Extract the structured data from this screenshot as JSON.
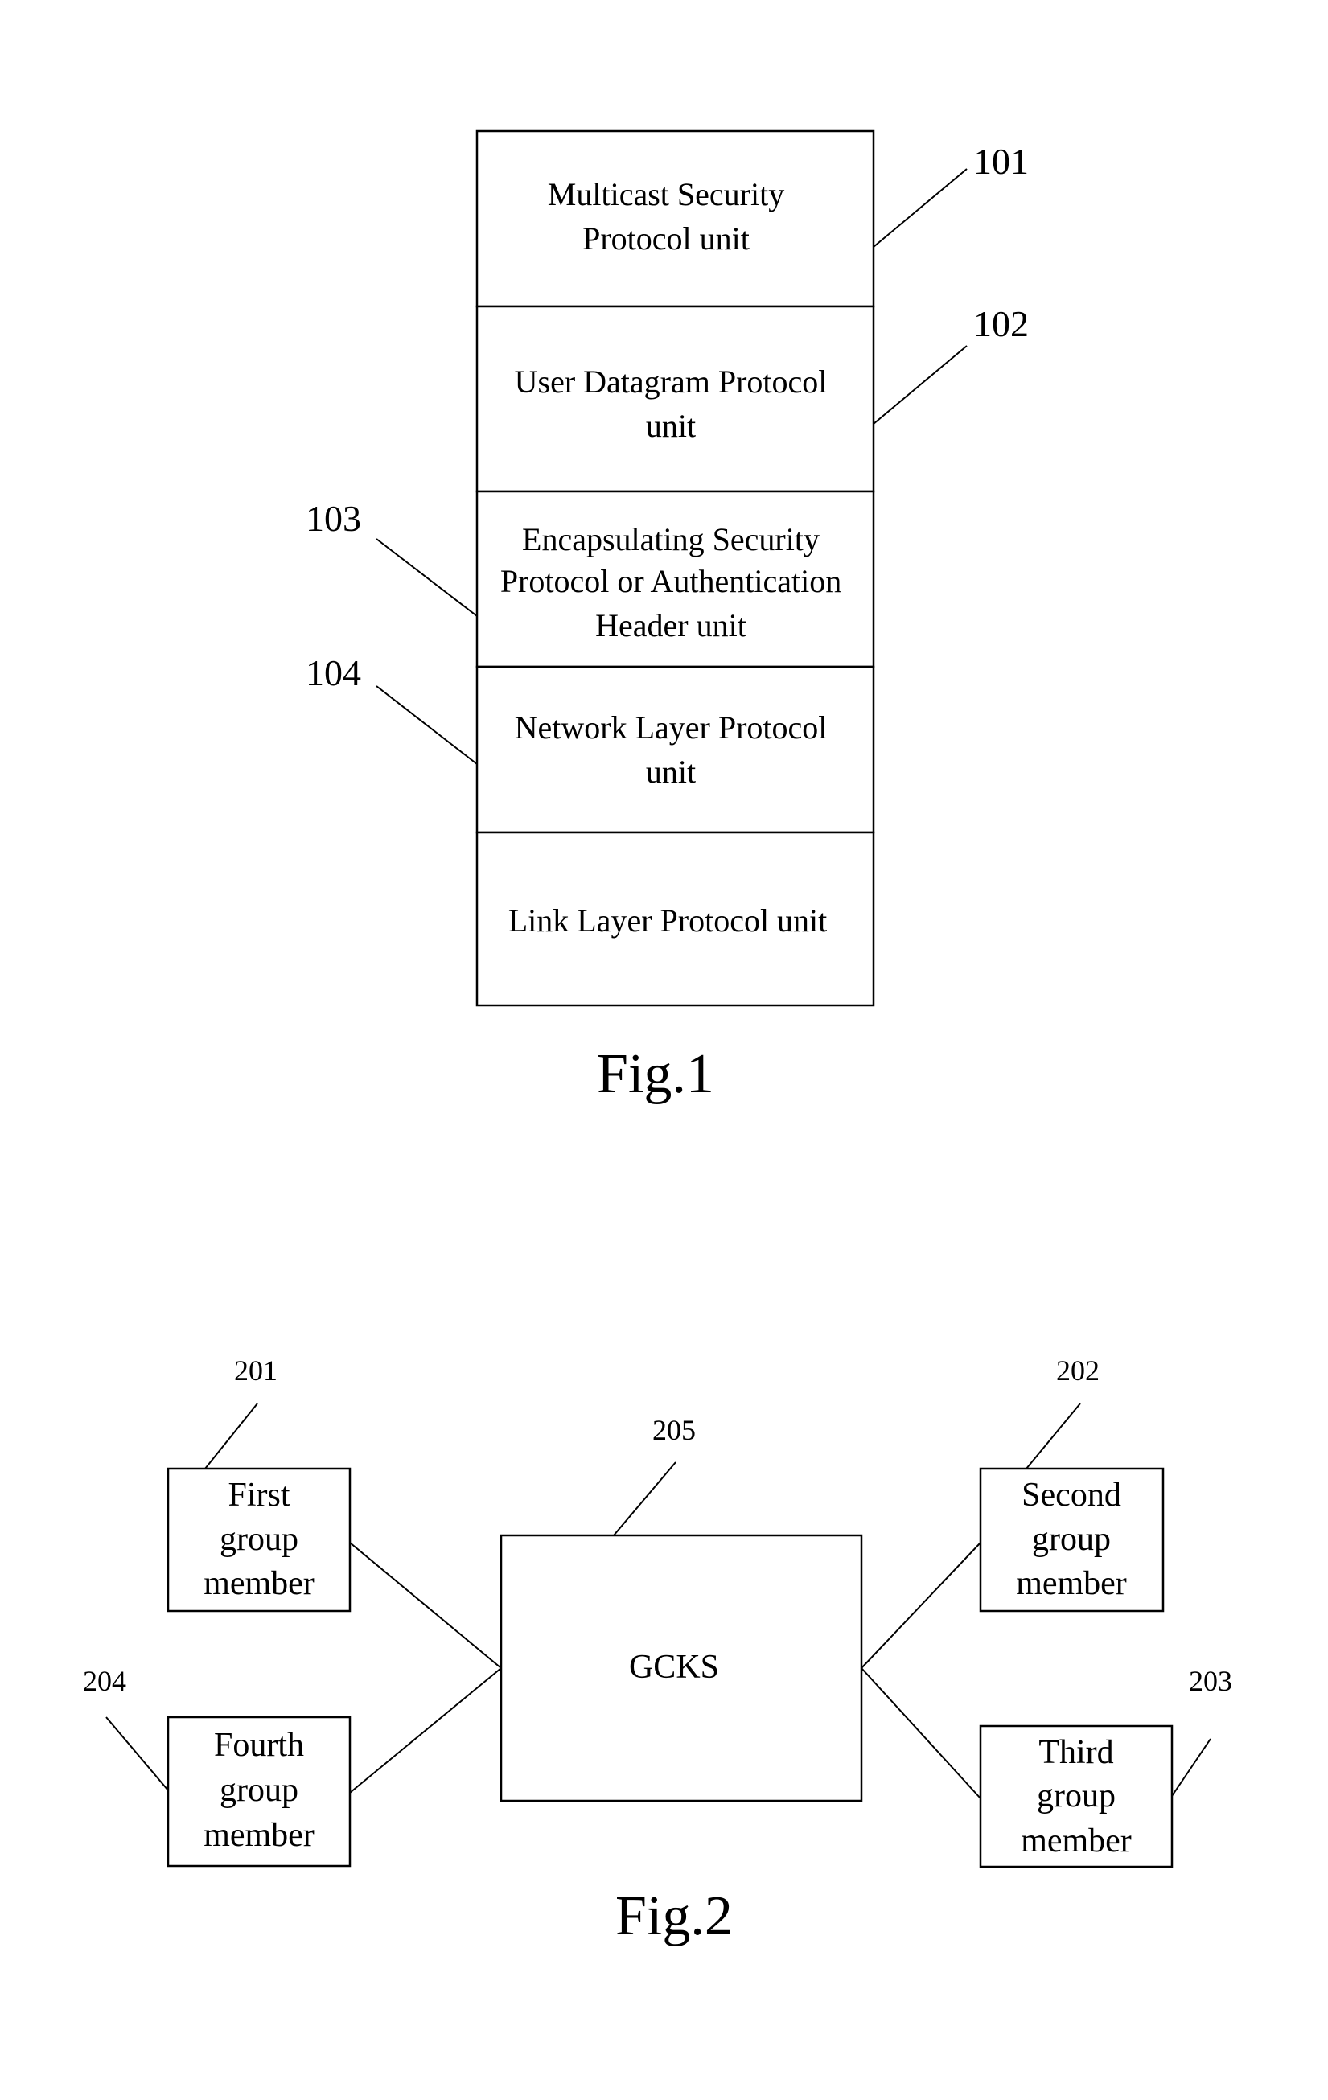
{
  "fig1": {
    "caption": "Fig.1",
    "units": [
      {
        "ref": "101",
        "lines": [
          "Multicast Security",
          "Protocol unit"
        ]
      },
      {
        "ref": "102",
        "lines": [
          "User Datagram Protocol",
          "unit"
        ]
      },
      {
        "ref": "103",
        "lines": [
          "Encapsulating Security",
          "Protocol or Authentication",
          "Header unit"
        ]
      },
      {
        "ref": "104",
        "lines": [
          "Network Layer Protocol",
          "unit"
        ]
      },
      {
        "ref": "",
        "lines": [
          "Link Layer Protocol unit"
        ]
      }
    ]
  },
  "fig2": {
    "caption": "Fig.2",
    "gcks": {
      "ref": "205",
      "label": "GCKS"
    },
    "members": [
      {
        "ref": "201",
        "lines": [
          "First",
          "group",
          "member"
        ]
      },
      {
        "ref": "202",
        "lines": [
          "Second",
          "group",
          "member"
        ]
      },
      {
        "ref": "203",
        "lines": [
          "Third",
          "group",
          "member"
        ]
      },
      {
        "ref": "204",
        "lines": [
          "Fourth",
          "group",
          "member"
        ]
      }
    ]
  }
}
